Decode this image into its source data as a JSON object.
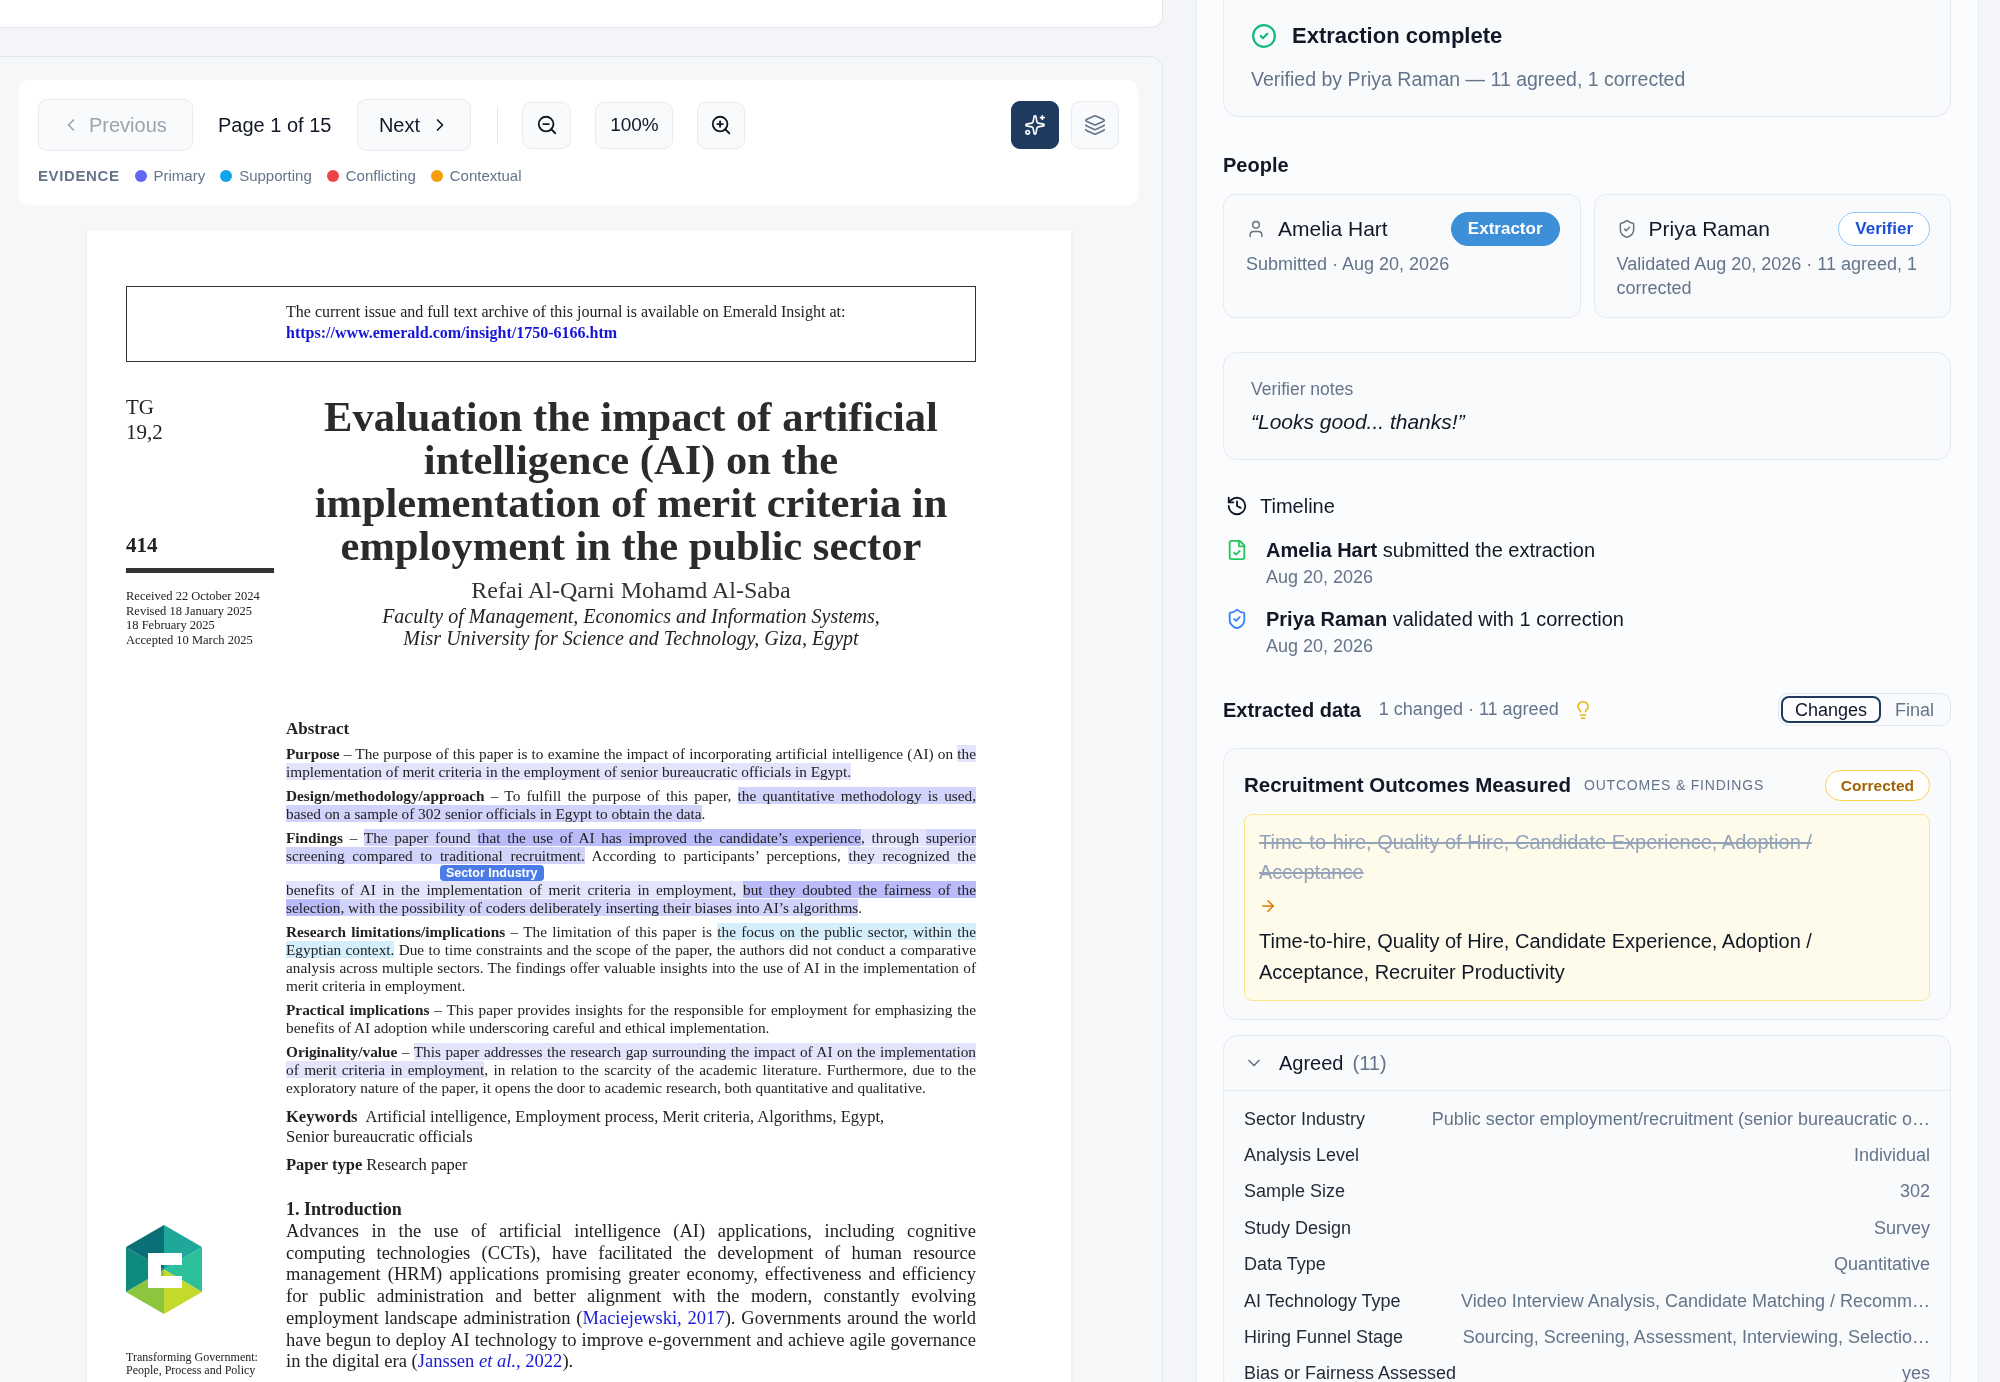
{
  "toolbar": {
    "previous": {
      "label": "Previous",
      "disabled": true
    },
    "page_indicator": "Page 1 of 15",
    "next": {
      "label": "Next",
      "disabled": false
    },
    "zoom_level": "100%",
    "tools": [
      {
        "kind": "sparkles",
        "on": true
      },
      {
        "kind": "layers",
        "on": false
      }
    ]
  },
  "legend": {
    "title": "EVIDENCE",
    "items": [
      {
        "label": "Primary",
        "color": "#6366f1"
      },
      {
        "label": "Supporting",
        "color": "#0ea5e9"
      },
      {
        "label": "Conflicting",
        "color": "#ef4444"
      },
      {
        "label": "Contextual",
        "color": "#f59e0b"
      }
    ]
  },
  "document": {
    "notice": "The current issue and full text archive of this journal is available on Emerald Insight at:",
    "notice_link": "https://www.emerald.com/insight/1750-6166.htm",
    "volume": [
      "TG",
      "19,2"
    ],
    "page_number": "414",
    "history": [
      "Received 22 October 2024",
      "Revised 18 January 2025",
      "18 February 2025",
      "Accepted 10 March 2025"
    ],
    "journal_name": "Transforming Government: People, Process and Policy",
    "title": "Evaluation the impact of artificial intelligence (AI) on the implementation of merit criteria in employment in the public sector",
    "authors": "Refai Al-Qarni Mohamd Al-Saba",
    "affiliation": "Faculty of Management, Economics and Information Systems, Misr University for Science and Technology, Giza, Egypt",
    "abstract_heading": "Abstract",
    "abstract": [
      {
        "heading": "Purpose",
        "segments": [
          {
            "text": "– The purpose of this paper is to examine the impact of incorporating artificial intelligence (AI) on "
          },
          {
            "text": "the implementation of merit criteria in the employment of senior bureaucratic officials in Egypt.",
            "color": "#e3e3fc"
          }
        ]
      },
      {
        "heading": "Design/methodology/approach",
        "segments": [
          {
            "text": "– To fulfill the purpose of this paper, "
          },
          {
            "text": "the quantitative methodology is used, based on a sample of 302 senior officials in Egypt to obtain the data",
            "color": "#d2d3fb"
          },
          {
            "text": "."
          }
        ]
      },
      {
        "heading": "Findings",
        "segments": [
          {
            "text": "– "
          },
          {
            "text": "The paper found ",
            "color": "#d2d3fb"
          },
          {
            "text": "that the use of AI has improved the candidate’s experience",
            "color": "#babcf9"
          },
          {
            "text": ", through ",
            "color": "#e3e3fc"
          },
          {
            "text": "superior screening compared to ",
            "color": "#d2d3fb"
          },
          {
            "text": "traditional recruitment.",
            "color": "#d2d3fb",
            "tag": "Sector Industry"
          },
          {
            "text": " According to participants’ perceptions, "
          },
          {
            "text": "they recognized the benefits of AI in the implementation of merit criteria in employment, ",
            "color": "#e3e3fc"
          },
          {
            "text": "but they doubted the fairness of the selection",
            "color": "#babcf9"
          },
          {
            "text": ", with the possibility of coders deliberately inserting their biases into AI’s algorithms",
            "color": "#d2d3fb"
          },
          {
            "text": "."
          }
        ]
      },
      {
        "heading": "Research limitations/implications",
        "segments": [
          {
            "text": "– The limitation of this paper is "
          },
          {
            "text": "the focus on the public sector, within the Egyptian context.",
            "color": "#d4effb"
          },
          {
            "text": " Due to time constraints and the scope of the paper, the authors did not conduct a comparative analysis across multiple sectors. The findings offer valuable insights into the use of AI in the implementation of merit criteria in employment."
          }
        ]
      },
      {
        "heading": "Practical implications",
        "segments": [
          {
            "text": "– This paper provides insights for the responsible for employment for emphasizing the benefits of AI adoption while underscoring careful and ethical implementation."
          }
        ]
      },
      {
        "heading": "Originality/value",
        "segments": [
          {
            "text": "– "
          },
          {
            "text": "This paper addresses the research gap surrounding the impact of AI on the implementation of merit criteria in employment",
            "color": "#e3e3fc"
          },
          {
            "text": ", in relation to the scarcity of the academic literature. Furthermore, due to the exploratory nature of the paper, it opens the door to academic research, both quantitative and qualitative."
          }
        ]
      }
    ],
    "keywords": {
      "heading": "Keywords",
      "text": "Artificial intelligence, Employment process, Merit criteria, Algorithms, Egypt, Senior bureaucratic officials"
    },
    "paper_type": {
      "heading": "Paper type",
      "text": "Research paper"
    },
    "section_heading": "1. Introduction",
    "introduction": [
      {
        "kind": "text",
        "text": "Advances in the use of artificial intelligence (AI) applications, including cognitive computing technologies (CCTs), have facilitated the development of human resource management (HRM) applications promising greater economy, effectiveness and efficiency for public administration and better alignment with the modern, constantly evolving employment landscape administration ("
      },
      {
        "kind": "link",
        "text": "Maciejewski, 2017"
      },
      {
        "kind": "text",
        "text": "). Governments around the world have begun to deploy AI technology to improve e-government and achieve agile governance in the digital era ("
      },
      {
        "kind": "link",
        "text": "Janssen *et al.*, 2022"
      },
      {
        "kind": "text",
        "text": ")."
      }
    ]
  },
  "status": {
    "title": "Extraction complete",
    "subtitle": "Verified by Priya Raman — 11 agreed, 1 corrected"
  },
  "people": {
    "title": "People",
    "members": [
      {
        "kind": "extractor",
        "name": "Amelia Hart",
        "role": "Extractor",
        "detail": "Submitted · Aug 20, 2026"
      },
      {
        "kind": "verifier",
        "name": "Priya Raman",
        "role": "Verifier",
        "detail": "Validated Aug 20, 2026 · 11 agreed, 1 corrected"
      }
    ]
  },
  "notes": {
    "label": "Verifier notes",
    "text": "“Looks good... thanks!”"
  },
  "timeline": {
    "title": "Timeline",
    "events": [
      {
        "kind": "submitted",
        "text": "**Amelia Hart** submitted the extraction",
        "date": "Aug 20, 2026"
      },
      {
        "kind": "validated",
        "text": "**Priya Raman** validated with 1 correction",
        "date": "Aug 20, 2026"
      }
    ]
  },
  "extracted_data": {
    "title": "Extracted data",
    "summary": "1 changed · 11 agreed",
    "views": [
      {
        "label": "Changes",
        "selected": true
      },
      {
        "label": "Final",
        "selected": false
      }
    ],
    "changes": [
      {
        "field": "Recruitment Outcomes Measured",
        "category": "OUTCOMES & FINDINGS",
        "status": "Corrected",
        "old_value": "Time-to-hire, Quality of Hire, Candidate Experience, Adoption / Acceptance",
        "new_value": "Time-to-hire, Quality of Hire, Candidate Experience, Adoption / Acceptance, Recruiter Productivity"
      }
    ],
    "agreed": {
      "title": "Agreed",
      "count": "(11)",
      "expanded": true,
      "rows": [
        {
          "label": "Sector Industry",
          "value": "Public sector employment/recruitment (senior bureaucratic o…"
        },
        {
          "label": "Analysis Level",
          "value": "Individual"
        },
        {
          "label": "Sample Size",
          "value": "302"
        },
        {
          "label": "Study Design",
          "value": "Survey"
        },
        {
          "label": "Data Type",
          "value": "Quantitative"
        },
        {
          "label": "AI Technology Type",
          "value": "Video Interview Analysis, Candidate Matching / Recomm…"
        },
        {
          "label": "Hiring Funnel Stage",
          "value": "Sourcing, Screening, Assessment, Interviewing, Selectio…"
        },
        {
          "label": "Bias or Fairness Assessed",
          "value": "yes"
        }
      ]
    }
  }
}
